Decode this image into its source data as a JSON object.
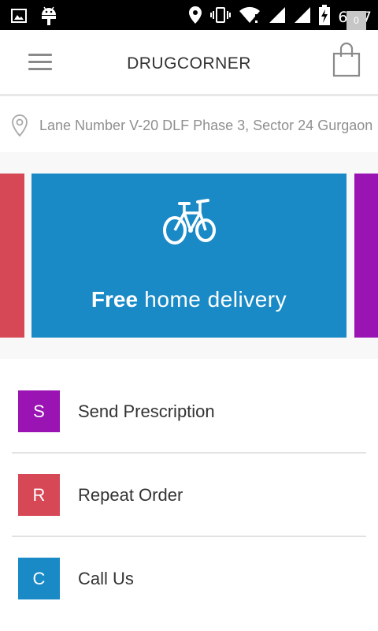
{
  "status_bar": {
    "time": "6:47",
    "icons": [
      "image-icon",
      "android-icon",
      "location-icon",
      "vibrate-icon",
      "wifi-icon",
      "signal-icon",
      "signal-icon",
      "battery-charging-icon"
    ]
  },
  "header": {
    "title": "DRUGCORNER",
    "cart_count": "0"
  },
  "address": {
    "text": "Lane Number V-20 DLF Phase 3, Sector 24 Gurgaon"
  },
  "banner": {
    "bold": "Free",
    "rest": " home delivery",
    "colors": {
      "prev": "#d64856",
      "main": "#1a8ac7",
      "next": "#9a13b3"
    }
  },
  "actions": [
    {
      "initial": "S",
      "label": "Send Prescription",
      "color": "#9a13b3"
    },
    {
      "initial": "R",
      "label": "Repeat Order",
      "color": "#d64856"
    },
    {
      "initial": "C",
      "label": "Call Us",
      "color": "#1a8ac7"
    }
  ]
}
